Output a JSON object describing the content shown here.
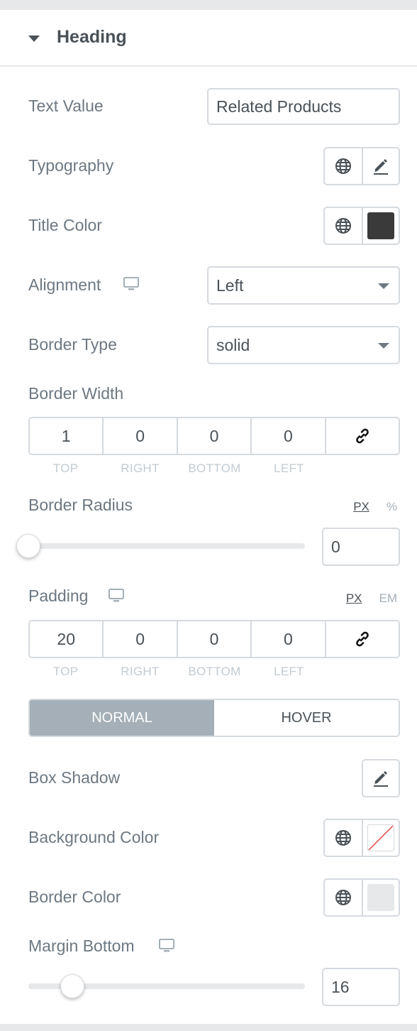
{
  "section": {
    "title": "Heading"
  },
  "text_value": {
    "label": "Text Value",
    "value": "Related Products"
  },
  "typography": {
    "label": "Typography"
  },
  "title_color": {
    "label": "Title Color",
    "color": "#3a3a3a"
  },
  "alignment": {
    "label": "Alignment",
    "value": "Left"
  },
  "border_type": {
    "label": "Border Type",
    "value": "solid"
  },
  "border_width": {
    "label": "Border Width",
    "top": "1",
    "right": "0",
    "bottom": "0",
    "left": "0",
    "side_labels": [
      "TOP",
      "RIGHT",
      "BOTTOM",
      "LEFT"
    ]
  },
  "border_radius": {
    "label": "Border Radius",
    "unit_active": "PX",
    "unit_other": "%",
    "value": "0",
    "level": 0
  },
  "padding": {
    "label": "Padding",
    "unit_active": "PX",
    "unit_other": "EM",
    "top": "20",
    "right": "0",
    "bottom": "0",
    "left": "0",
    "side_labels": [
      "TOP",
      "RIGHT",
      "BOTTOM",
      "LEFT"
    ]
  },
  "state_tabs": {
    "normal": "NORMAL",
    "hover": "HOVER",
    "active": "normal"
  },
  "box_shadow": {
    "label": "Box Shadow"
  },
  "background_color": {
    "label": "Background Color",
    "color": "none"
  },
  "border_color": {
    "label": "Border Color",
    "color": "#e6e8ea"
  },
  "margin_bottom": {
    "label": "Margin Bottom",
    "value": "16"
  },
  "icons": {
    "section_toggle": "caret-down-icon",
    "global": "globe-icon",
    "edit": "pencil-icon",
    "responsive": "desktop-icon",
    "link": "link-icon",
    "dropdown": "chevron-down-icon"
  },
  "colors": {
    "accent_gray": "#a4afb7",
    "text": "#495157",
    "label": "#6d7882",
    "border": "#d5dadf"
  }
}
